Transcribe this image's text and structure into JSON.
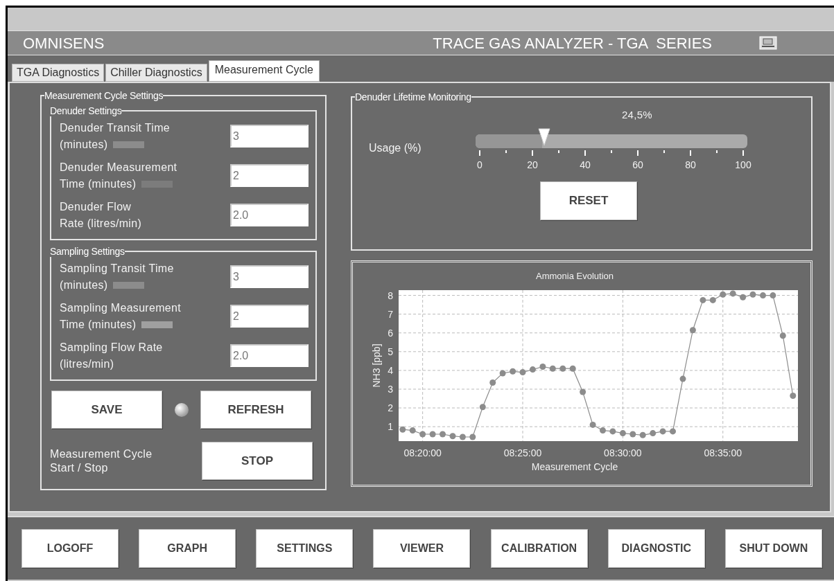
{
  "header": {
    "brand": "OMNISENS",
    "title": "TRACE GAS ANALYZER - TGA  SERIES"
  },
  "tabs": [
    {
      "label": "TGA Diagnostics",
      "selected": false
    },
    {
      "label": "Chiller Diagnostics",
      "selected": false
    },
    {
      "label": "Measurement Cycle",
      "selected": true
    }
  ],
  "cycle_settings": {
    "title": "Measurement Cycle Settings",
    "groups": [
      {
        "title": "Denuder Settings",
        "fields": [
          {
            "label_lines": [
              "Denuder Transit Time",
              "(minutes)"
            ],
            "value": "3",
            "color": "#8c8c8c"
          },
          {
            "label_lines": [
              "Denuder Measurement",
              "Time (minutes)"
            ],
            "value": "2",
            "color": "#7c7c7c"
          },
          {
            "label_lines": [
              "Denuder Flow",
              "Rate (litres/min)"
            ],
            "value": "2.0"
          }
        ]
      },
      {
        "title": "Sampling Settings",
        "fields": [
          {
            "label_lines": [
              "Sampling Transit Time",
              "(minutes)"
            ],
            "value": "3",
            "color": "#8c8c8c"
          },
          {
            "label_lines": [
              "Sampling Measurement",
              "Time (minutes)"
            ],
            "value": "2",
            "color": "#a0a0a0"
          },
          {
            "label_lines": [
              "Sampling Flow Rate",
              "(litres/min)"
            ],
            "value": "2.0"
          }
        ]
      }
    ],
    "save_button": "SAVE",
    "save_led": {
      "on": false
    },
    "refresh_button": "REFRESH",
    "cycle_label_lines": [
      "Measurement Cycle",
      "Start / Stop"
    ],
    "stop_button": "STOP"
  },
  "lifetime": {
    "title": "Denuder Lifetime Monitoring",
    "label": "Usage (%)",
    "reading": "24,5%",
    "level": 0.245,
    "scale": [
      "0",
      "20",
      "40",
      "60",
      "80",
      "100"
    ],
    "reset_button": "RESET"
  },
  "chart_panel": {
    "chart_data": {
      "type": "line",
      "title": "Ammonia Evolution",
      "xlabel": "Measurement Cycle",
      "ylabel": "NH3 [ppb]",
      "categories": [
        null,
        null,
        "08:20:00",
        null,
        null,
        null,
        null,
        null,
        null,
        null,
        null,
        null,
        "08:25:00",
        null,
        null,
        null,
        null,
        null,
        null,
        null,
        null,
        null,
        "08:30:00",
        null,
        null,
        null,
        null,
        null,
        null,
        null,
        null,
        null,
        "08:35:00",
        null,
        null,
        null,
        null,
        null,
        null,
        null
      ],
      "grid": true,
      "series": [
        {
          "color": "#8c8c8c",
          "marker": "circle",
          "values": [
            0.85,
            0.8,
            0.6,
            0.6,
            0.6,
            0.5,
            0.45,
            0.45,
            2.05,
            3.35,
            3.85,
            3.95,
            3.9,
            4.05,
            4.2,
            4.1,
            4.1,
            4.1,
            2.85,
            1.1,
            0.8,
            0.75,
            0.65,
            0.6,
            0.55,
            0.65,
            0.75,
            0.75,
            3.55,
            6.15,
            7.75,
            7.75,
            8.05,
            8.1,
            7.9,
            8.05,
            8.0,
            8.0,
            5.85,
            2.65
          ]
        }
      ],
      "ylim": [
        0.23,
        8.28
      ],
      "yticks": [
        1,
        2,
        3,
        4,
        5,
        6,
        7,
        8
      ]
    }
  },
  "bottom_buttons": [
    "LOGOFF",
    "GRAPH",
    "SETTINGS",
    "VIEWER",
    "CALIBRATION",
    "DIAGNOSTIC",
    "SHUT DOWN"
  ]
}
